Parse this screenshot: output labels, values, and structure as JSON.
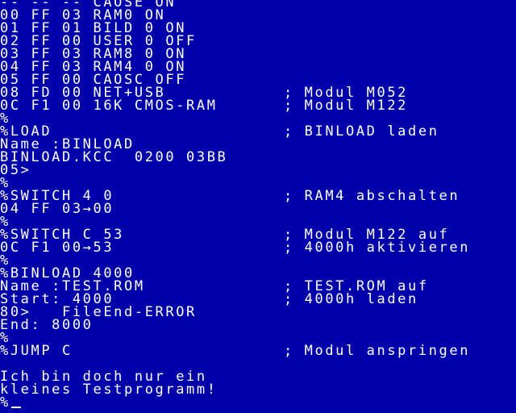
{
  "terminal": {
    "background": "#0000aa",
    "foreground": "#ffffff",
    "prompt": "%",
    "lines": [
      {
        "text": "-- -- -- CAOSE ON",
        "comment": ""
      },
      {
        "text": "00 FF 03 RAM0 ON",
        "comment": ""
      },
      {
        "text": "01 FF 01 BILD 0 ON",
        "comment": ""
      },
      {
        "text": "02 FF 00 USER 0 OFF",
        "comment": ""
      },
      {
        "text": "03 FF 03 RAM8 0 ON",
        "comment": ""
      },
      {
        "text": "04 FF 03 RAM4 0 ON",
        "comment": ""
      },
      {
        "text": "05 FF 00 CAOSC OFF",
        "comment": ""
      },
      {
        "text": "08 FD 00 NET+USB",
        "comment": "; Modul M052"
      },
      {
        "text": "0C F1 00 16K CMOS-RAM",
        "comment": "; Modul M122"
      },
      {
        "text": "%",
        "comment": ""
      },
      {
        "text": "%LOAD",
        "comment": "; BINLOAD laden"
      },
      {
        "text": "Name :BINLOAD",
        "comment": ""
      },
      {
        "text": "BINLOAD.KCC  0200 03BB",
        "comment": ""
      },
      {
        "text": "05>",
        "comment": ""
      },
      {
        "text": "%",
        "comment": ""
      },
      {
        "text": "%SWITCH 4 0",
        "comment": "; RAM4 abschalten"
      },
      {
        "text": "04 FF 03→00",
        "comment": ""
      },
      {
        "text": "%",
        "comment": ""
      },
      {
        "text": "%SWITCH C 53",
        "comment": "; Modul M122 auf"
      },
      {
        "text": "0C F1 00→53",
        "comment": "; 4000h aktivieren"
      },
      {
        "text": "%",
        "comment": ""
      },
      {
        "text": "%BINLOAD 4000",
        "comment": ""
      },
      {
        "text": "Name :TEST.ROM",
        "comment": "; TEST.ROM auf"
      },
      {
        "text": "Start: 4000",
        "comment": "; 4000h laden"
      },
      {
        "text": "80>   FileEnd-ERROR",
        "comment": ""
      },
      {
        "text": "End: 8000",
        "comment": ""
      },
      {
        "text": "%",
        "comment": ""
      },
      {
        "text": "%JUMP C",
        "comment": "; Modul anspringen"
      },
      {
        "text": "",
        "comment": ""
      },
      {
        "text": "Ich bin doch nur ein",
        "comment": ""
      },
      {
        "text": "kleines Testprogramm!",
        "comment": ""
      },
      {
        "text": "%",
        "comment": ""
      }
    ]
  }
}
